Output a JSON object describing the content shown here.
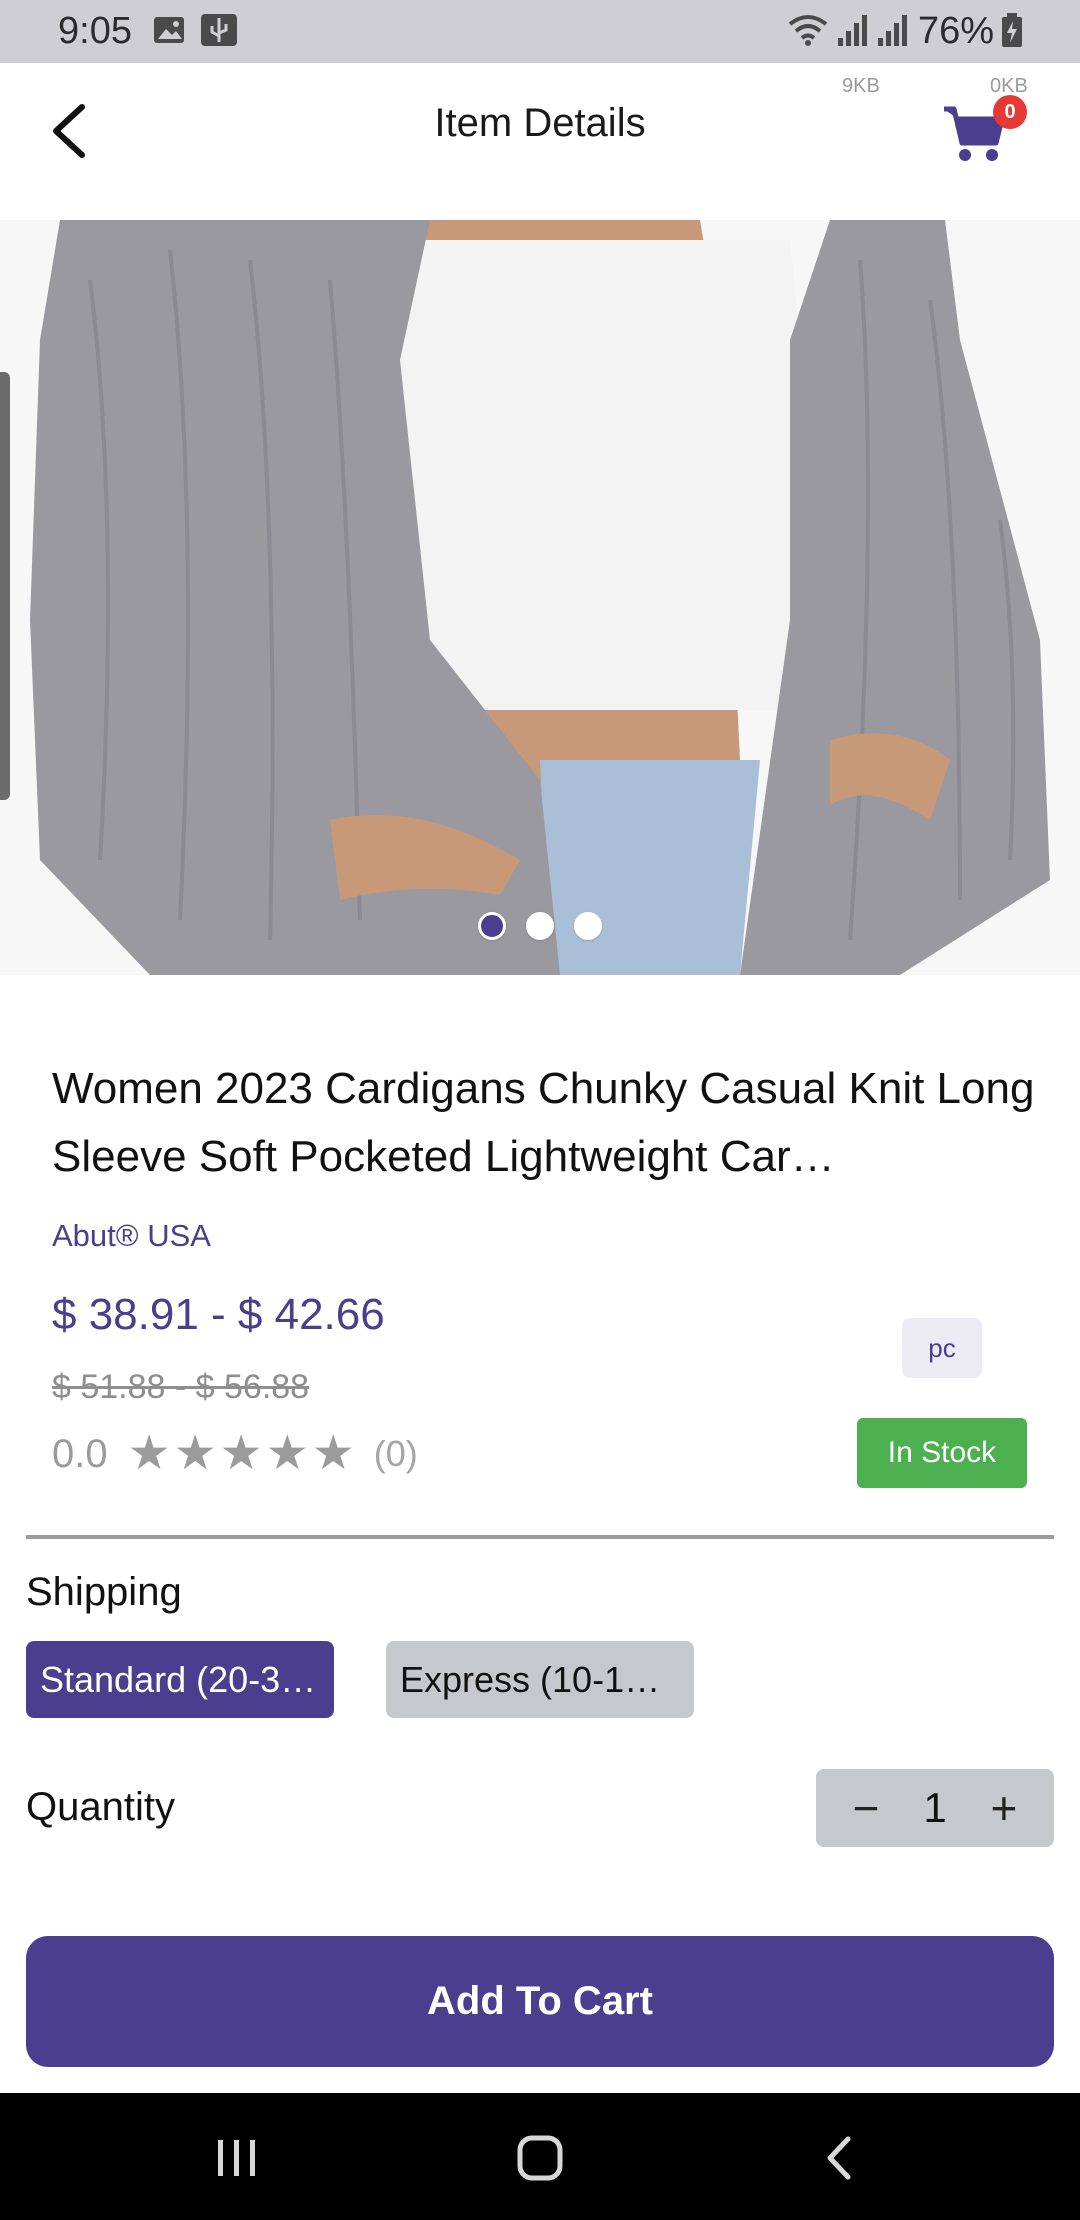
{
  "status_bar": {
    "time": "9:05",
    "battery": "76%",
    "icons": [
      "image-icon",
      "usb-icon",
      "wifi-icon",
      "signal-icon",
      "signal-icon",
      "battery-charging-icon"
    ]
  },
  "header": {
    "title": "Item Details",
    "net_up": "9KB",
    "net_down": "0KB",
    "cart_count": "0"
  },
  "gallery": {
    "image_count": 3,
    "active_index": 0
  },
  "product": {
    "title": "Women 2023 Cardigans Chunky Casual Knit Long Sleeve Soft Pocketed Lightweight Car…",
    "brand": "Abut® USA",
    "price": "$ 38.91 - $ 42.66",
    "old_price": "$ 51.88 - $ 56.88",
    "rating": "0.0",
    "stars": 0,
    "review_count": "(0)",
    "unit": "pc",
    "stock_status": "In Stock"
  },
  "shipping": {
    "label": "Shipping",
    "options": [
      {
        "label": "Standard (20-3…",
        "selected": true
      },
      {
        "label": "Express (10-1…",
        "selected": false
      }
    ]
  },
  "quantity": {
    "label": "Quantity",
    "value": "1",
    "minus": "−",
    "plus": "+"
  },
  "actions": {
    "add_to_cart": "Add To Cart"
  },
  "colors": {
    "accent": "#4c3e8f",
    "stock_green": "#4caf50",
    "badge_red": "#e53935"
  }
}
